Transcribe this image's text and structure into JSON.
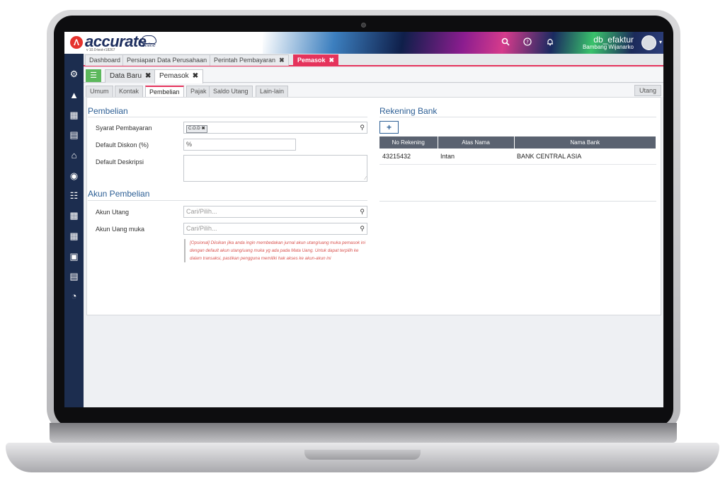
{
  "app": {
    "logo_mark": "Λ",
    "name": "accurate",
    "tagline": "online",
    "version": "v 10.0-test-r18267"
  },
  "topbar": {
    "db_name": "db_efaktur",
    "user_name": "Bambang Wijanarko",
    "icons": [
      "search-icon",
      "help-icon",
      "bell-icon"
    ],
    "accent_color": "#e5335c"
  },
  "sidebar": {
    "items": [
      "settings-icon",
      "company-icon",
      "bank-icon",
      "ledger-icon",
      "purchase-icon",
      "sales-icon",
      "cart-icon",
      "delivery-icon",
      "inventory-icon",
      "asset-icon",
      "report-icon",
      "analysis-icon"
    ]
  },
  "module_tabs": [
    {
      "label": "Dashboard",
      "closable": false,
      "active": false
    },
    {
      "label": "Persiapan Data Perusahaan",
      "closable": false,
      "active": false
    },
    {
      "label": "Perintah Pembayaran",
      "closable": true,
      "active": false
    },
    {
      "label": "Pemasok",
      "closable": true,
      "active": true
    }
  ],
  "form_tabs": [
    {
      "label": "Data Baru",
      "closable": true,
      "active": false
    },
    {
      "label": "Pemasok",
      "closable": true,
      "active": true
    }
  ],
  "sub_tabs": [
    {
      "label": "Umum",
      "active": false
    },
    {
      "label": "Kontak",
      "active": false
    },
    {
      "label": "Pembelian",
      "active": true
    },
    {
      "label": "Pajak",
      "active": false
    },
    {
      "label": "Saldo Utang",
      "active": false
    },
    {
      "label": "Lain-lain",
      "active": false
    }
  ],
  "right_tab": "Utang",
  "pembelian": {
    "title": "Pembelian",
    "syarat_label": "Syarat Pembayaran",
    "syarat_value": "C.O.D",
    "diskon_label": "Default Diskon (%)",
    "diskon_prefix": "%",
    "deskripsi_label": "Default Deskripsi"
  },
  "akun": {
    "title": "Akun Pembelian",
    "utang_label": "Akun Utang",
    "utang_placeholder": "Cari/Pilih...",
    "uang_muka_label": "Akun Uang muka",
    "uang_muka_placeholder": "Cari/Pilih...",
    "note": "[Opsional] Diisikan jika anda ingin membedakan jurnal akun utang/uang muka pemasok ini dengan default akun utang/uang muka yg ada pada Mata Uang. Untuk dapat terpilih ke dalam transaksi, pastikan pengguna memiliki hak akses ke akun-akun ini"
  },
  "rekening": {
    "title": "Rekening Bank",
    "add_label": "+",
    "columns": [
      "No Rekening",
      "Atas Nama",
      "Nama Bank"
    ],
    "rows": [
      [
        "43215432",
        "Intan",
        "BANK CENTRAL ASIA"
      ]
    ]
  }
}
